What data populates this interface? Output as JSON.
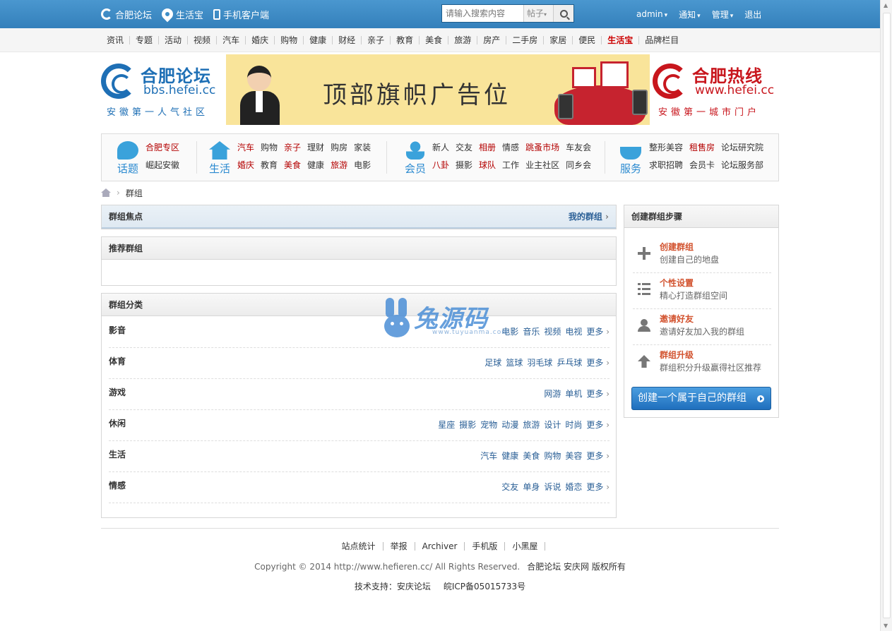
{
  "topbar": {
    "site_label": "合肥论坛",
    "life_label": "生活宝",
    "mobile_label": "手机客户端",
    "search_placeholder": "请输入搜索内容",
    "search_type": "帖子",
    "user": "admin",
    "notify": "通知",
    "manage": "管理",
    "logout": "退出"
  },
  "nav": [
    "资讯",
    "专题",
    "活动",
    "视频",
    "汽车",
    "婚庆",
    "购物",
    "健康",
    "财经",
    "亲子",
    "教育",
    "美食",
    "旅游",
    "房产",
    "二手房",
    "家居",
    "便民",
    "生活宝",
    "品牌栏目"
  ],
  "nav_highlight": "生活宝",
  "header": {
    "logo_left": {
      "title": "合肥论坛",
      "sub": "bbs.hefei.cc",
      "slogan": "安徽第一人气社区"
    },
    "banner_text": "顶部旗帜广告位",
    "logo_right": {
      "title": "合肥热线",
      "sub": "www.hefei.cc",
      "slogan": "安徽第一城市门户"
    }
  },
  "categories": [
    {
      "icon": "speech-bubble-icon",
      "label": "话题",
      "links": [
        {
          "t": "合肥专区",
          "red": true
        },
        {
          "t": "崛起安徽",
          "red": false
        }
      ]
    },
    {
      "icon": "house-icon",
      "label": "生活",
      "links": [
        {
          "t": "汽车",
          "red": true
        },
        {
          "t": "购物",
          "red": false
        },
        {
          "t": "亲子",
          "red": true
        },
        {
          "t": "理财",
          "red": false
        },
        {
          "t": "购房",
          "red": false
        },
        {
          "t": "家装",
          "red": false
        },
        {
          "t": "婚庆",
          "red": true
        },
        {
          "t": "教育",
          "red": false
        },
        {
          "t": "美食",
          "red": true
        },
        {
          "t": "健康",
          "red": false
        },
        {
          "t": "旅游",
          "red": true
        },
        {
          "t": "电影",
          "red": false
        }
      ]
    },
    {
      "icon": "member-icon",
      "label": "会员",
      "links": [
        {
          "t": "新人",
          "red": false
        },
        {
          "t": "交友",
          "red": false
        },
        {
          "t": "相册",
          "red": true
        },
        {
          "t": "情感",
          "red": false
        },
        {
          "t": "跳蚤市场",
          "red": true
        },
        {
          "t": "车友会",
          "red": false
        },
        {
          "t": "八卦",
          "red": true
        },
        {
          "t": "摄影",
          "red": false
        },
        {
          "t": "球队",
          "red": true
        },
        {
          "t": "工作",
          "red": false
        },
        {
          "t": "业主社区",
          "red": false
        },
        {
          "t": "同乡会",
          "red": false
        }
      ]
    },
    {
      "icon": "coffee-cup-icon",
      "label": "服务",
      "links": [
        {
          "t": "整形美容",
          "red": false
        },
        {
          "t": "租售房",
          "red": true
        },
        {
          "t": "论坛研究院",
          "red": false
        },
        {
          "t": "求职招聘",
          "red": false
        },
        {
          "t": "会员卡",
          "red": false
        },
        {
          "t": "论坛服务部",
          "red": false
        }
      ]
    }
  ],
  "breadcrumb": {
    "current": "群组"
  },
  "focus": {
    "title": "群组焦点",
    "my_groups": "我的群组"
  },
  "recommend": {
    "title": "推荐群组"
  },
  "classify": {
    "title": "群组分类",
    "more": "更多",
    "rows": [
      {
        "name": "影音",
        "links": [
          "电影",
          "音乐",
          "视频",
          "电视"
        ]
      },
      {
        "name": "体育",
        "links": [
          "足球",
          "篮球",
          "羽毛球",
          "乒乓球"
        ]
      },
      {
        "name": "游戏",
        "links": [
          "网游",
          "单机"
        ]
      },
      {
        "name": "休闲",
        "links": [
          "星座",
          "摄影",
          "宠物",
          "动漫",
          "旅游",
          "设计",
          "时尚"
        ]
      },
      {
        "name": "生活",
        "links": [
          "汽车",
          "健康",
          "美食",
          "购物",
          "美容"
        ]
      },
      {
        "name": "情感",
        "links": [
          "交友",
          "单身",
          "诉说",
          "婚恋"
        ]
      }
    ]
  },
  "watermark": {
    "text": "兔源码",
    "url": "www.tuyuanma.com"
  },
  "sidebar": {
    "title": "创建群组步骤",
    "steps": [
      {
        "icon": "plus-icon",
        "title": "创建群组",
        "desc": "创建自己的地盘"
      },
      {
        "icon": "list-icon",
        "title": "个性设置",
        "desc": "精心打造群组空间"
      },
      {
        "icon": "user-icon",
        "title": "邀请好友",
        "desc": "邀请好友加入我的群组"
      },
      {
        "icon": "arrow-up-icon",
        "title": "群组升级",
        "desc": "群组积分升级赢得社区推荐"
      }
    ],
    "button": "创建一个属于自己的群组"
  },
  "footer": {
    "links": [
      "站点统计",
      "举报",
      "Archiver",
      "手机版",
      "小黑屋"
    ],
    "copyright": "Copyright © 2014 http://www.hefieren.cc/ All Rights Reserved.",
    "owner": "合肥论坛 安庆网 版权所有",
    "tech": "技术支持：安庆论坛",
    "icp": "皖ICP备05015733号"
  }
}
